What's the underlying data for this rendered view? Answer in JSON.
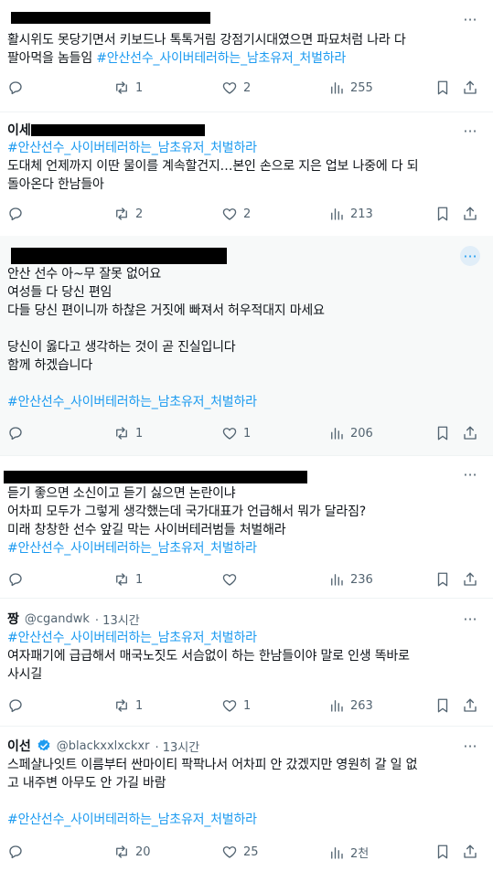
{
  "more_label": "···",
  "tweets": [
    {
      "name": "",
      "handle": "",
      "time": "",
      "lines": [
        {
          "text": "활시위도 못당기면서 키보드나 톡톡거림 강점기시대였으면 파묘처럼 나라 다",
          "tag": false
        },
        {
          "text": "팔아먹을 놈들임 ",
          "tag": false,
          "extra": "#안산선수_사이버테러하는_남초유저_처벌하라"
        }
      ],
      "reply": "",
      "retweet": "1",
      "like": "2",
      "views": "255"
    },
    {
      "name": "이세",
      "handle": "",
      "time": "",
      "lines": [
        {
          "text": "#안산선수_사이버테러하는_남초유저_처벌하라",
          "tag": true
        },
        {
          "text": "도대체 언제까지 이딴 물이를 계속할건지…본인 손으로 지은 업보 나중에 다 되",
          "tag": false
        },
        {
          "text": "돌아온다 한남들아",
          "tag": false
        }
      ],
      "reply": "",
      "retweet": "2",
      "like": "2",
      "views": "213"
    },
    {
      "name": "",
      "handle": "",
      "time": "",
      "lines": [
        {
          "text": "안산 선수 아~무 잘못 없어요",
          "tag": false
        },
        {
          "text": "여성들 다 당신 편임",
          "tag": false
        },
        {
          "text": "다들 당신 편이니까 하찮은 거짓에 빠져서 허우적대지 마세요",
          "tag": false
        },
        {
          "text": "",
          "tag": false
        },
        {
          "text": "당신이 옳다고 생각하는 것이 곧 진실입니다",
          "tag": false
        },
        {
          "text": "함께 하겠습니다",
          "tag": false
        },
        {
          "text": "",
          "tag": false
        },
        {
          "text": "#안산선수_사이버테러하는_남초유저_처벌하라",
          "tag": true
        }
      ],
      "reply": "",
      "retweet": "1",
      "like": "1",
      "views": "206"
    },
    {
      "name": "",
      "handle": "",
      "time": "",
      "lines": [
        {
          "text": "듣기 좋으면 소신이고 듣기 싫으면 논란이냐",
          "tag": false
        },
        {
          "text": "어차피 모두가 그렇게 생각했는데 국가대표가 언급해서 뭐가 달라짐?",
          "tag": false
        },
        {
          "text": "미래 창창한 선수 앞길 막는 사이버테러범들 처벌해라",
          "tag": false
        },
        {
          "text": "#안산선수_사이버테러하는_남초유저_처벌하라",
          "tag": true
        }
      ],
      "reply": "",
      "retweet": "1",
      "like": "",
      "views": "236"
    },
    {
      "name": "짱",
      "handle": "@cgandwk",
      "time": "· 13시간",
      "lines": [
        {
          "text": "#안산선수_사이버테러하는_남초유저_처벌하라",
          "tag": true
        },
        {
          "text": "여자패기에 급급해서 매국노짓도 서슴없이 하는 한남들이야 말로 인생 똑바로",
          "tag": false
        },
        {
          "text": "사시길",
          "tag": false
        }
      ],
      "reply": "",
      "retweet": "1",
      "like": "1",
      "views": "263"
    },
    {
      "name": "이선",
      "handle": "@blackxxlxckxr",
      "time": "· 13시간",
      "lines": [
        {
          "text": "스페샬나잇트 이름부터 싼마이티 팍팍나서 어차피 안 갔겠지만 영원히 갈 일 없",
          "tag": false
        },
        {
          "text": "고 내주변 아무도 안 가길 바람",
          "tag": false
        },
        {
          "text": "",
          "tag": false
        },
        {
          "text": "#안산선수_사이버테러하는_남초유저_처벌하라",
          "tag": true
        }
      ],
      "reply": "",
      "retweet": "20",
      "like": "25",
      "views": "2천"
    }
  ]
}
